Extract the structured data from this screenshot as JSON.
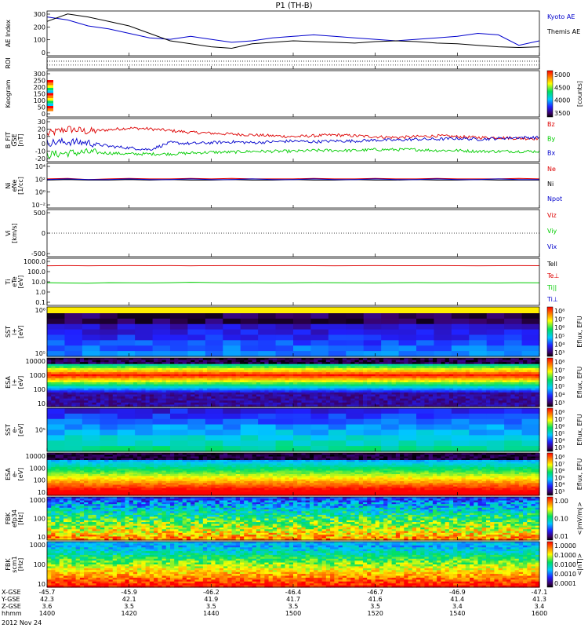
{
  "title": "P1 (TH-B)",
  "date": "2012 Nov 24",
  "colors": {
    "kyoto": "#0000cc",
    "themis": "#000000",
    "red": "#dd0000",
    "green": "#00cc00",
    "blue": "#0000cc"
  },
  "chart_data": [
    {
      "panel": "ae",
      "type": "line",
      "ylabel": "AE Index",
      "ylim": [
        0,
        300
      ],
      "yticks": [
        "300",
        "200",
        "100",
        "0"
      ],
      "x": [
        1400,
        1405,
        1410,
        1415,
        1420,
        1425,
        1430,
        1435,
        1440,
        1445,
        1450,
        1455,
        1500,
        1505,
        1510,
        1515,
        1520,
        1525,
        1530,
        1535,
        1540,
        1545,
        1550,
        1555,
        1600
      ],
      "series": [
        {
          "name": "Kyoto AE",
          "values": [
            260,
            240,
            200,
            180,
            150,
            120,
            110,
            130,
            110,
            90,
            100,
            120,
            130,
            140,
            130,
            120,
            110,
            100,
            110,
            120,
            130,
            150,
            140,
            70,
            100
          ]
        },
        {
          "name": "Themis AE",
          "values": [
            230,
            280,
            260,
            230,
            200,
            150,
            100,
            80,
            60,
            50,
            80,
            90,
            100,
            95,
            90,
            85,
            95,
            100,
            95,
            85,
            80,
            70,
            60,
            55,
            60
          ]
        }
      ]
    },
    {
      "panel": "roi",
      "type": "line",
      "ylabel": "ROI"
    },
    {
      "panel": "keogram",
      "type": "heatmap",
      "ylabel": "Keogram",
      "ylim": [
        0,
        300
      ],
      "yticks": [
        "300",
        "250",
        "200",
        "150",
        "100",
        "50",
        "0"
      ],
      "colorbar": {
        "label": "[counts]",
        "ticks": [
          "5000",
          "4500",
          "4000",
          "3500"
        ]
      }
    },
    {
      "panel": "bfield",
      "type": "line",
      "ylabel": "B_FIT",
      "ylabel2": "GSE",
      "ylabel3": "[nT]",
      "ylim": [
        -20,
        30
      ],
      "yticks": [
        "30",
        "20",
        "10",
        "0",
        "-10",
        "-20"
      ],
      "series": [
        {
          "name": "Bz",
          "values": [
            12,
            18,
            15,
            17,
            19,
            18,
            16,
            14,
            13,
            12,
            11,
            10,
            9,
            10,
            11,
            10,
            9,
            8,
            9,
            10,
            9,
            8,
            8,
            7,
            7
          ]
        },
        {
          "name": "By",
          "values": [
            -12,
            -10,
            -9,
            -10,
            -11,
            -11,
            -11,
            -10,
            -9,
            -9,
            -8,
            -8,
            -8,
            -7,
            -7,
            -7,
            -6,
            -6,
            -6,
            -7,
            -7,
            -8,
            -8,
            -8,
            -8
          ]
        },
        {
          "name": "Bx",
          "values": [
            2,
            3,
            2,
            -2,
            -4,
            -6,
            2,
            1,
            2,
            3,
            2,
            3,
            4,
            3,
            4,
            4,
            5,
            5,
            6,
            6,
            7,
            6,
            7,
            8,
            8
          ]
        }
      ]
    },
    {
      "panel": "density",
      "type": "line",
      "ylabel": "Ni",
      "ylabel2": "eNe",
      "ylabel3": "[1/cc]",
      "ylim": [
        -3,
        5
      ],
      "yticks": [
        "10⁴",
        "10²",
        "10⁰",
        "10⁻²"
      ],
      "series": [
        {
          "name": "Ne",
          "values": [
            2.2,
            2.3,
            2.1,
            2.2,
            2.3,
            2.2,
            2.2,
            2.3,
            2.2,
            2.3,
            2.2,
            2.2,
            2.2,
            2.3,
            2.2,
            2.2,
            2.3,
            2.2,
            2.2,
            2.3,
            2.2,
            2.2,
            2.2,
            2.3,
            2.2
          ]
        },
        {
          "name": "Ni",
          "values": [
            2.0,
            2.1,
            2.0,
            2.0,
            2.1,
            2.0,
            2.1,
            2.0,
            2.0,
            2.1,
            2.0,
            2.0,
            2.1,
            2.0,
            2.0,
            2.1,
            2.0,
            2.0,
            2.1,
            2.0,
            2.0,
            2.1,
            2.0,
            2.0,
            2.0
          ]
        },
        {
          "name": "Npot",
          "values": [
            2.1,
            2.2,
            2.1,
            2.1,
            2.2,
            2.1,
            2.1,
            2.2,
            2.1,
            2.1,
            2.2,
            2.1,
            2.1,
            2.2,
            2.1,
            2.1,
            2.2,
            2.1,
            2.1,
            2.2,
            2.1,
            2.1,
            2.2,
            2.1,
            2.1
          ]
        }
      ]
    },
    {
      "panel": "velocity",
      "type": "line",
      "ylabel": "Vi",
      "ylabel3": "[km/s]",
      "ylim": [
        -500,
        500
      ],
      "yticks": [
        "500",
        "0",
        "-500"
      ],
      "series": [
        {
          "name": "Viz",
          "values": []
        },
        {
          "name": "Viy",
          "values": []
        },
        {
          "name": "Vix",
          "values": []
        }
      ]
    },
    {
      "panel": "temperature",
      "type": "line",
      "ylabel": "Ti",
      "ylabel2": "eTe",
      "ylabel3": "[eV]",
      "ylim": [
        -1.3,
        4
      ],
      "yticks": [
        "1000.0",
        "100.0",
        "10.0",
        "1.0",
        "0.1"
      ],
      "series": [
        {
          "name": "Tell",
          "values": []
        },
        {
          "name": "Te⊥",
          "values": [
            3.15,
            3.17,
            3.15,
            3.16,
            3.17,
            3.16,
            3.17,
            3.15,
            3.16,
            3.17,
            3.16,
            3.16,
            3.17,
            3.16,
            3.15,
            3.16,
            3.17,
            3.16,
            3.16,
            3.17,
            3.16,
            3.15,
            3.16,
            3.17,
            3.16
          ]
        },
        {
          "name": "Ti||",
          "values": [
            1.25,
            1.22,
            1.2,
            1.25,
            1.24,
            1.23,
            1.25,
            1.3,
            1.26,
            1.24,
            1.25,
            1.23,
            1.24,
            1.26,
            1.25,
            1.24,
            1.23,
            1.25,
            1.26,
            1.24,
            1.25,
            1.24,
            1.23,
            1.25,
            1.24
          ]
        },
        {
          "name": "Ti⊥",
          "values": []
        }
      ]
    },
    {
      "panel": "sst_i",
      "type": "heatmap",
      "ylabel": "SST",
      "ylabel2": "i+",
      "ylabel3": "[eV]",
      "yticks": [
        "10⁶",
        "10⁵"
      ],
      "colorbar": {
        "label": "Eflux, EFU",
        "ticks": [
          "10⁸",
          "10⁷",
          "10⁶",
          "10⁵",
          "10⁴",
          "10³"
        ]
      }
    },
    {
      "panel": "esa_i",
      "type": "heatmap",
      "ylabel": "ESA",
      "ylabel2": "i+",
      "ylabel3": "[eV]",
      "yticks": [
        "10000",
        "1000",
        "100",
        "10"
      ],
      "colorbar": {
        "label": "Eflux, EFU",
        "ticks": [
          "10⁸",
          "10⁷",
          "10⁶",
          "10⁵",
          "10⁴",
          "10³"
        ]
      }
    },
    {
      "panel": "sst_e",
      "type": "heatmap",
      "ylabel": "SST",
      "ylabel2": "e-",
      "ylabel3": "[eV]",
      "yticks": [
        "10⁵"
      ],
      "colorbar": {
        "label": "Eflux, EFU",
        "ticks": [
          "10⁸",
          "10⁷",
          "10⁶",
          "10⁵",
          "10⁴",
          "10³"
        ]
      }
    },
    {
      "panel": "esa_e",
      "type": "heatmap",
      "ylabel": "ESA",
      "ylabel2": "e-",
      "ylabel3": "[eV]",
      "yticks": [
        "10000",
        "1000",
        "100",
        "10"
      ],
      "colorbar": {
        "label": "Eflux, EFU",
        "ticks": [
          "10⁸",
          "10⁷",
          "10⁶",
          "10⁵",
          "10⁴",
          "10³"
        ]
      }
    },
    {
      "panel": "fbk_e",
      "type": "heatmap",
      "ylabel": "FBK",
      "ylabel2": "efp34",
      "ylabel3": "[Hz]",
      "yticks": [
        "1000",
        "100",
        "10"
      ],
      "colorbar": {
        "label": "<|mV/m|>",
        "ticks": [
          "1.00",
          "0.10",
          "0.01"
        ]
      }
    },
    {
      "panel": "fbk_b",
      "type": "heatmap",
      "ylabel": "FBK",
      "ylabel2": "scm1",
      "ylabel3": "[Hz]",
      "yticks": [
        "1000",
        "100",
        "10"
      ],
      "colorbar": {
        "label": "<|nT|>",
        "ticks": [
          "1.0000",
          "0.1000",
          "0.0100",
          "0.0010",
          "0.0001"
        ]
      }
    }
  ],
  "xaxis": {
    "row_labels": [
      "X-GSE",
      "Y-GSE",
      "Z-GSE",
      "hhmm"
    ],
    "columns": [
      [
        "-45.7",
        "42.3",
        "3.6",
        "1400"
      ],
      [
        "-45.9",
        "42.1",
        "3.5",
        "1420"
      ],
      [
        "-46.2",
        "41.9",
        "3.5",
        "1440"
      ],
      [
        "-46.4",
        "41.7",
        "3.5",
        "1500"
      ],
      [
        "-46.7",
        "41.6",
        "3.5",
        "1520"
      ],
      [
        "-46.9",
        "41.4",
        "3.4",
        "1540"
      ],
      [
        "-47.1",
        "41.3",
        "3.4",
        "1600"
      ]
    ]
  }
}
